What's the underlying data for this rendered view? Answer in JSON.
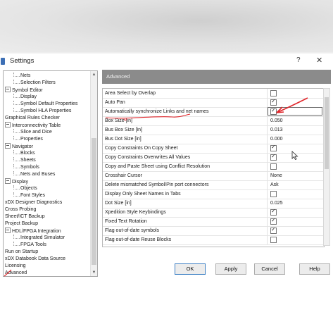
{
  "window": {
    "title": "Settings",
    "help_label": "?",
    "close_label": "✕"
  },
  "tree": {
    "items": [
      {
        "label": "Nets",
        "level": 2
      },
      {
        "label": "Selection Filters",
        "level": 2
      },
      {
        "label": "Symbol Editor",
        "level": 1,
        "expanded": true
      },
      {
        "label": "Display",
        "level": 2
      },
      {
        "label": "Symbol Default Properties",
        "level": 2
      },
      {
        "label": "Symbol HLA Properties",
        "level": 2
      },
      {
        "label": "Graphical Rules Checker",
        "level": 1
      },
      {
        "label": "Interconnectivity Table",
        "level": 1,
        "expanded": true
      },
      {
        "label": "Slice and Dice",
        "level": 2
      },
      {
        "label": "Properties",
        "level": 2
      },
      {
        "label": "Navigator",
        "level": 1,
        "expanded": true
      },
      {
        "label": "Blocks",
        "level": 2
      },
      {
        "label": "Sheets",
        "level": 2
      },
      {
        "label": "Symbols",
        "level": 2
      },
      {
        "label": "Nets and Buses",
        "level": 2
      },
      {
        "label": "Display",
        "level": 1,
        "expanded": true
      },
      {
        "label": "Objects",
        "level": 2
      },
      {
        "label": "Font Styles",
        "level": 2
      },
      {
        "label": "xDX Designer Diagnostics",
        "level": 1
      },
      {
        "label": "Cross Probing",
        "level": 1
      },
      {
        "label": "Sheet/ICT Backup",
        "level": 1
      },
      {
        "label": "Project Backup",
        "level": 1
      },
      {
        "label": "HDL/FPGA Integration",
        "level": 1,
        "expanded": true
      },
      {
        "label": "Integrated Simulator",
        "level": 2
      },
      {
        "label": "FPGA Tools",
        "level": 2
      },
      {
        "label": "Run on Startup",
        "level": 1
      },
      {
        "label": "xDX Databook Data Source",
        "level": 1
      },
      {
        "label": "Licensing",
        "level": 1
      },
      {
        "label": "Advanced",
        "level": 1,
        "selected": true
      }
    ]
  },
  "panel": {
    "title": "Advanced",
    "rows": [
      {
        "label": "Area Select by Overlap",
        "type": "checkbox",
        "checked": false
      },
      {
        "label": "Auto Pan",
        "type": "checkbox",
        "checked": true
      },
      {
        "label": "Automatically synchronize Links and net names",
        "type": "checkbox",
        "checked": true,
        "highlighted": true
      },
      {
        "label": "Box Size [in]",
        "type": "text",
        "value": "0.050"
      },
      {
        "label": "Bus Box Size [in]",
        "type": "text",
        "value": "0.013"
      },
      {
        "label": "Bus Dot Size [in]",
        "type": "text",
        "value": "0.000"
      },
      {
        "label": "Copy Constraints On Copy Sheet",
        "type": "checkbox",
        "checked": true
      },
      {
        "label": "Copy Constraints Overwrites All Values",
        "type": "checkbox",
        "checked": true
      },
      {
        "label": "Copy and Paste Sheet using Conflict Resolution",
        "type": "checkbox",
        "checked": false
      },
      {
        "label": "Crosshair Cursor",
        "type": "text",
        "value": "None"
      },
      {
        "label": "Delete mismatched Symbol/Pin port connectors",
        "type": "text",
        "value": "Ask"
      },
      {
        "label": "Display Only Sheet Names in Tabs",
        "type": "checkbox",
        "checked": false
      },
      {
        "label": "Dot Size [in]",
        "type": "text",
        "value": "0.025"
      },
      {
        "label": "Xpedition Style Keybindings",
        "type": "checkbox",
        "checked": true
      },
      {
        "label": "Fixed Text Rotation",
        "type": "checkbox",
        "checked": true
      },
      {
        "label": "Flag out-of-date symbols",
        "type": "checkbox",
        "checked": true
      },
      {
        "label": "Flag out-of-date Reuse Blocks",
        "type": "checkbox",
        "checked": false
      }
    ]
  },
  "buttons": {
    "ok": "OK",
    "apply": "Apply",
    "cancel": "Cancel",
    "help": "Help"
  },
  "colors": {
    "annotation": "#e0262b",
    "header_bg": "#8b8b8b",
    "default_button_border": "#3c7fc4"
  }
}
